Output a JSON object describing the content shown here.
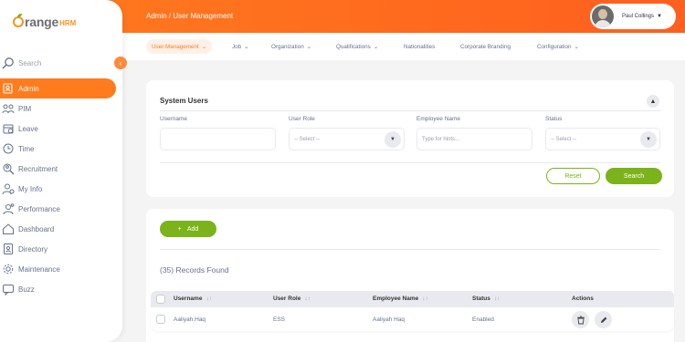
{
  "brand": {
    "name_main": "range",
    "name_suffix": "HRM"
  },
  "sidebar": {
    "search_label": "Search",
    "collapse_icon": "chevron-left-icon",
    "items": [
      {
        "label": "Admin",
        "icon": "admin-icon",
        "active": true
      },
      {
        "label": "PIM",
        "icon": "pim-icon"
      },
      {
        "label": "Leave",
        "icon": "leave-icon"
      },
      {
        "label": "Time",
        "icon": "time-icon"
      },
      {
        "label": "Recruitment",
        "icon": "recruitment-icon"
      },
      {
        "label": "My Info",
        "icon": "my-info-icon"
      },
      {
        "label": "Performance",
        "icon": "performance-icon"
      },
      {
        "label": "Dashboard",
        "icon": "dashboard-icon"
      },
      {
        "label": "Directory",
        "icon": "directory-icon"
      },
      {
        "label": "Maintenance",
        "icon": "maintenance-icon"
      },
      {
        "label": "Buzz",
        "icon": "buzz-icon"
      }
    ]
  },
  "topbar": {
    "breadcrumb": "Admin / User Management",
    "user_name": "Paul Collings"
  },
  "subnav": {
    "tabs": [
      {
        "label": "User Management",
        "has_caret": true,
        "active": true
      },
      {
        "label": "Job",
        "has_caret": true
      },
      {
        "label": "Organization",
        "has_caret": true
      },
      {
        "label": "Qualifications",
        "has_caret": true
      },
      {
        "label": "Nationalities",
        "has_caret": false
      },
      {
        "label": "Corporate Branding",
        "has_caret": false
      },
      {
        "label": "Configuration",
        "has_caret": true
      }
    ]
  },
  "filter": {
    "title": "System Users",
    "fields": {
      "username": {
        "label": "Username",
        "value": ""
      },
      "user_role": {
        "label": "User Role",
        "value": "-- Select --"
      },
      "employee_name": {
        "label": "Employee Name",
        "placeholder": "Type for hints..."
      },
      "status": {
        "label": "Status",
        "value": "-- Select --"
      }
    },
    "reset_label": "Reset",
    "search_label": "Search"
  },
  "records": {
    "add_label": "Add",
    "count_text": "(35) Records Found",
    "columns": [
      "Username",
      "User Role",
      "Employee Name",
      "Status",
      "Actions"
    ],
    "rows": [
      {
        "username": "Aaliyah.Haq",
        "role": "ESS",
        "employee": "Aaliyah Haq",
        "status": "Enabled"
      }
    ]
  },
  "colors": {
    "primary": "#ff7b1d",
    "success": "#7bb31a",
    "text": "#64728c"
  }
}
